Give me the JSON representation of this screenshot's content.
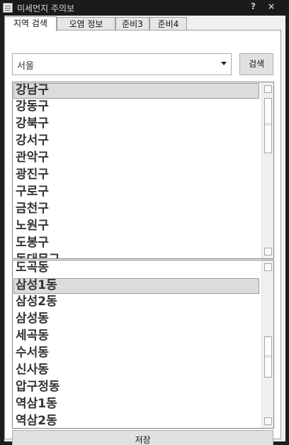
{
  "window": {
    "title": "미세먼지 주의보",
    "help_glyph": "?",
    "close_glyph": "×"
  },
  "tabs": [
    {
      "label": "지역 검색",
      "active": true
    },
    {
      "label": "오염 정보",
      "active": false
    },
    {
      "label": "준비3",
      "active": false
    },
    {
      "label": "준비4",
      "active": false
    }
  ],
  "search": {
    "city_selected": "서울",
    "button_label": "검색"
  },
  "districts": {
    "items": [
      "강남구",
      "강동구",
      "강북구",
      "강서구",
      "관악구",
      "광진구",
      "구로구",
      "금천구",
      "노원구",
      "도봉구",
      "동대문구"
    ],
    "selected": "강남구"
  },
  "dongs": {
    "items": [
      "도곡동",
      "삼성1동",
      "삼성2동",
      "삼성동",
      "세곡동",
      "수서동",
      "신사동",
      "압구정동",
      "역삼1동",
      "역삼2동"
    ],
    "selected": "삼성1동"
  },
  "save_label": "저장"
}
